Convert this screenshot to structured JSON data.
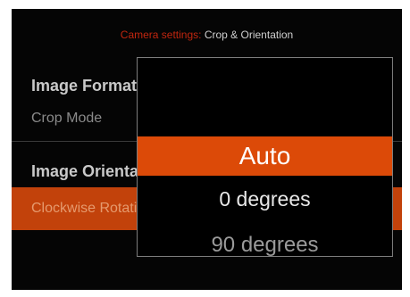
{
  "header": {
    "section": "Camera settings:",
    "page": "Crop & Orientation"
  },
  "menu": {
    "group1_title": "Image Format",
    "group1_item": "Crop Mode",
    "group2_title": "Image Orientation",
    "group2_item": "Clockwise Rotation"
  },
  "popup": {
    "options": [
      "Auto",
      "0 degrees",
      "90 degrees"
    ],
    "selected": "Auto"
  },
  "colors": {
    "accent": "#dc4a08",
    "selected_row": "#c2420b",
    "header_section": "#c2260f",
    "background": "#050505"
  }
}
